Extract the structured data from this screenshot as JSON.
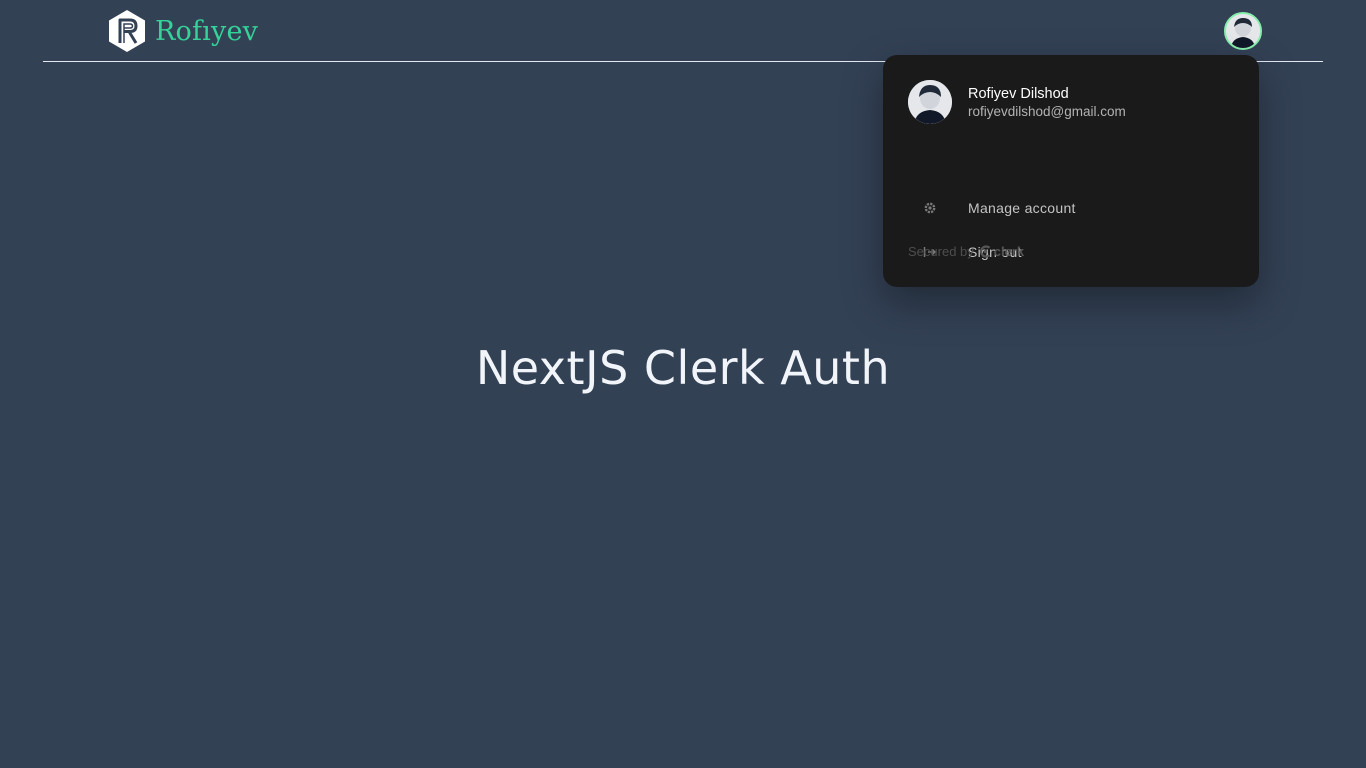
{
  "header": {
    "brand_name": "Rofıyev",
    "logo_icon": "hexagon-r-logo",
    "avatar_icon": "user-avatar"
  },
  "user_menu": {
    "name": "Rofiyev Dilshod",
    "email": "rofiyevdilshod@gmail.com",
    "items": [
      {
        "label": "Manage account",
        "icon": "gear-icon"
      },
      {
        "label": "Sign out",
        "icon": "sign-out-icon"
      }
    ],
    "footer": {
      "secured_by": "Secured by",
      "provider": "clerk"
    }
  },
  "main": {
    "title": "NextJS Clerk Auth"
  },
  "colors": {
    "background": "#334155",
    "brand": "#34d399",
    "menu_bg": "#1a1a1a",
    "avatar_ring": "#86efac"
  }
}
